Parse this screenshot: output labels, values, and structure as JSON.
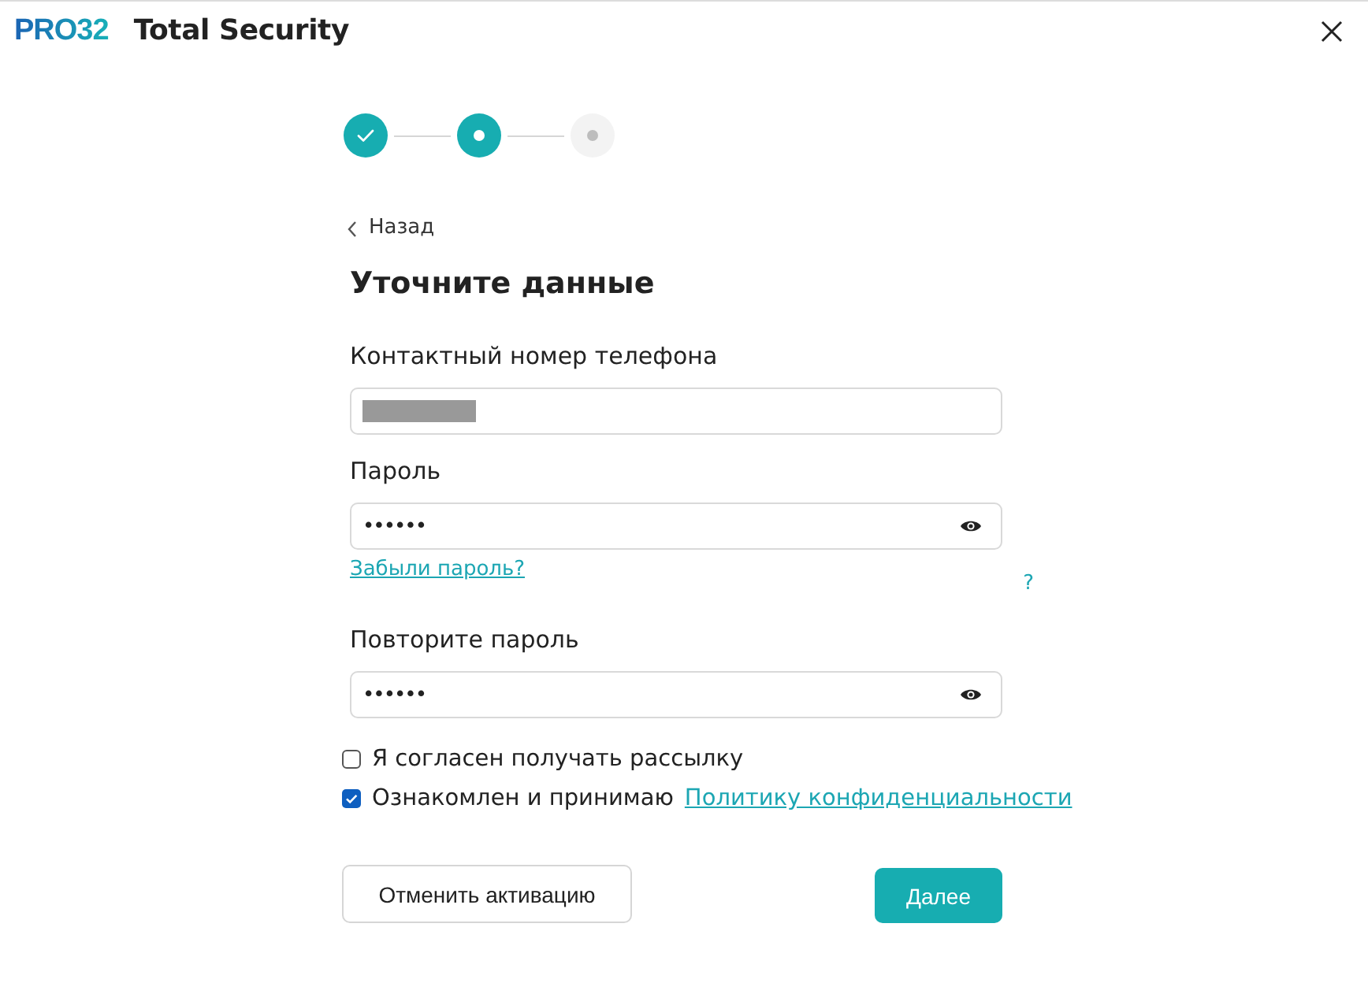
{
  "window": {
    "logo": "PRO32",
    "title": "Total Security"
  },
  "steps": [
    {
      "kind": "done"
    },
    {
      "kind": "current"
    },
    {
      "kind": "pending"
    }
  ],
  "form": {
    "back": "Назад",
    "title": "Уточните данные",
    "fields": [
      {
        "label": "Контактный номер телефона",
        "kind": "text",
        "redacted": true
      },
      {
        "label": "Пароль",
        "kind": "password",
        "value": "••••••",
        "link": "Забыли пароль?",
        "help": "?"
      },
      {
        "label": "Повторите пароль",
        "kind": "password",
        "value": "••••••"
      }
    ],
    "checkboxes": [
      {
        "label": "Я согласен получать рассылку",
        "checked": false
      },
      {
        "label": "Ознакомлен и принимаю",
        "link": "Политику конфиденциальности",
        "checked": true
      }
    ],
    "buttons": [
      {
        "label": "Отменить активацию",
        "kind": "secondary"
      },
      {
        "label": "Далее",
        "kind": "primary"
      }
    ]
  }
}
